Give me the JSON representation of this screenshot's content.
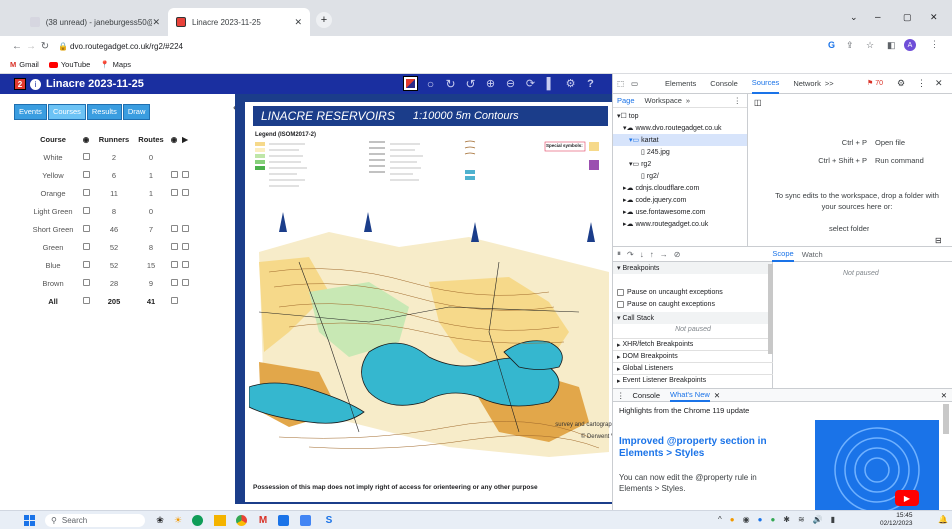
{
  "browser": {
    "tabs": [
      {
        "title": "(38 unread) - janeburgess50@y"
      },
      {
        "title": "Linacre 2023-11-25"
      }
    ],
    "url": "dvo.routegadget.co.uk/rg2/#224",
    "bookmarks": [
      "Gmail",
      "YouTube",
      "Maps"
    ],
    "profile_initial": "A"
  },
  "rg": {
    "title": "Linacre 2023-11-25",
    "tabs": [
      "Events",
      "Courses",
      "Results",
      "Draw"
    ],
    "headers": {
      "course": "Course",
      "runners": "Runners",
      "routes": "Routes"
    },
    "courses": [
      {
        "name": "White",
        "runners": "2",
        "routes": "0"
      },
      {
        "name": "Yellow",
        "runners": "6",
        "routes": "1"
      },
      {
        "name": "Orange",
        "runners": "11",
        "routes": "1"
      },
      {
        "name": "Light Green",
        "runners": "8",
        "routes": "0"
      },
      {
        "name": "Short Green",
        "runners": "46",
        "routes": "7"
      },
      {
        "name": "Green",
        "runners": "52",
        "routes": "8"
      },
      {
        "name": "Blue",
        "runners": "52",
        "routes": "15"
      },
      {
        "name": "Brown",
        "runners": "28",
        "routes": "9"
      },
      {
        "name": "All",
        "runners": "205",
        "routes": "41"
      }
    ]
  },
  "map": {
    "title": "LINACRE RESERVOIRS",
    "scale": "1:10000  5m Contours",
    "legend_title": "Legend (ISOM2017-2)",
    "special_symbols": "Special symbols:",
    "footer": "Possession of this map does not imply right of access for orienteering or any other purpose",
    "credit1": "survey and cartograph",
    "credit2": "© Derwent V"
  },
  "devtools": {
    "tabs": [
      "Elements",
      "Console",
      "Sources",
      "Network"
    ],
    "more": ">>",
    "issues_count": "70",
    "subtabs": [
      "Page",
      "Workspace"
    ],
    "tree": [
      "top",
      "www.dvo.routegadget.co.uk",
      "kartat",
      "245.jpg",
      "rg2",
      "rg2/",
      "cdnjs.cloudflare.com",
      "code.jquery.com",
      "use.fontawesome.com",
      "www.routegadget.co.uk"
    ],
    "shortcut1_key": "Ctrl + P",
    "shortcut1_label": "Open file",
    "shortcut2_key": "Ctrl + Shift + P",
    "shortcut2_label": "Run command",
    "workspace_hint": "To sync edits to the workspace, drop a folder with your sources here or:",
    "select_folder": "select folder",
    "scope_tabs": [
      "Scope",
      "Watch"
    ],
    "not_paused": "Not paused",
    "breakpoints": "Breakpoints",
    "pause_uncaught": "Pause on uncaught exceptions",
    "pause_caught": "Pause on caught exceptions",
    "call_stack": "Call Stack",
    "call_not_paused": "Not paused",
    "sections": [
      "XHR/fetch Breakpoints",
      "DOM Breakpoints",
      "Global Listeners",
      "Event Listener Breakpoints"
    ],
    "drawer_tabs": [
      "Console",
      "What's New"
    ],
    "whatsnew_highlight": "Highlights from the Chrome 119 update",
    "whatsnew_title": "Improved @property section in Elements > Styles",
    "whatsnew_body": "You can now edit the @property rule in Elements > Styles."
  },
  "taskbar": {
    "search": "Search",
    "time": "15:45",
    "date": "02/12/2023"
  }
}
